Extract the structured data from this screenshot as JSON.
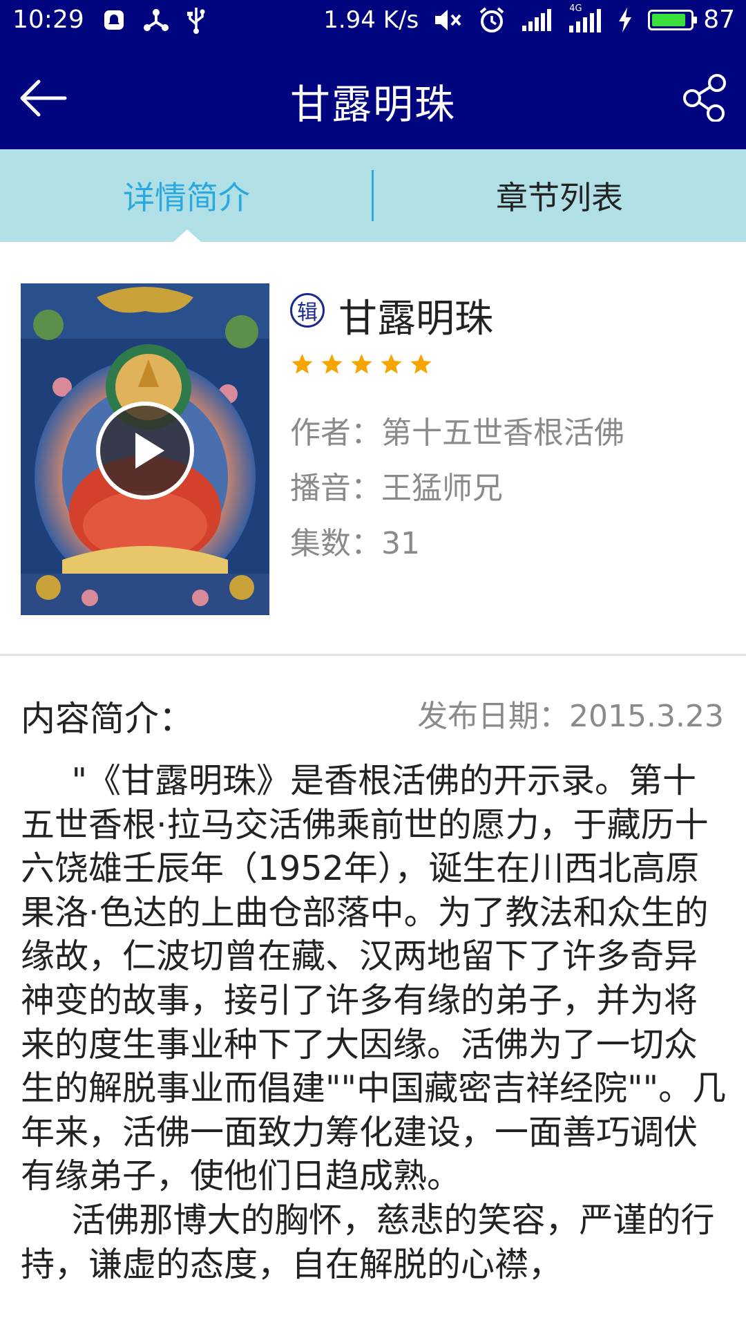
{
  "status_bar": {
    "time": "10:29",
    "speed": "1.94 K/s",
    "battery": "87",
    "network": "4G",
    "icons": [
      "notification-icon",
      "share-network-icon",
      "usb-icon",
      "mute-icon",
      "alarm-icon",
      "signal-icon",
      "signal-4g-icon",
      "charging-icon",
      "battery-icon"
    ]
  },
  "toolbar": {
    "title": "甘露明珠",
    "back_icon": "back-arrow-icon",
    "share_icon": "share-icon"
  },
  "tabs": [
    {
      "label": "详情简介",
      "active": true
    },
    {
      "label": "章节列表",
      "active": false
    }
  ],
  "album": {
    "badge": "辑",
    "title": "甘露明珠",
    "rating": 5,
    "author_label": "作者：",
    "author": "第十五世香根活佛",
    "narrator_label": "播音：",
    "narrator": "王猛师兄",
    "episodes_label": "集数：",
    "episodes": "31"
  },
  "content": {
    "heading": "内容简介：",
    "release": "发布日期：2015.3.23",
    "paragraphs": [
      "\"《甘露明珠》是香根活佛的开示录。第十五世香根·拉马交活佛乘前世的愿力，于藏历十六饶雄壬辰年（1952年），诞生在川西北高原果洛·色达的上曲仓部落中。为了教法和众生的缘故，仁波切曾在藏、汉两地留下了许多奇异神变的故事，接引了许多有缘的弟子，并为将来的度生事业种下了大因缘。活佛为了一切众生的解脱事业而倡建\"\"中国藏密吉祥经院\"\"。几年来，活佛一面致力筹化建设，一面善巧调伏有缘弟子，使他们日趋成熟。",
      "活佛那博大的胸怀，慈悲的笑容，严谨的行持，谦虚的态度，自在解脱的心襟，"
    ]
  },
  "colors": {
    "header": "#01047f",
    "tabs_bg": "#b0dfe6",
    "tab_active": "#2aa8e0",
    "star": "#f5a400"
  }
}
